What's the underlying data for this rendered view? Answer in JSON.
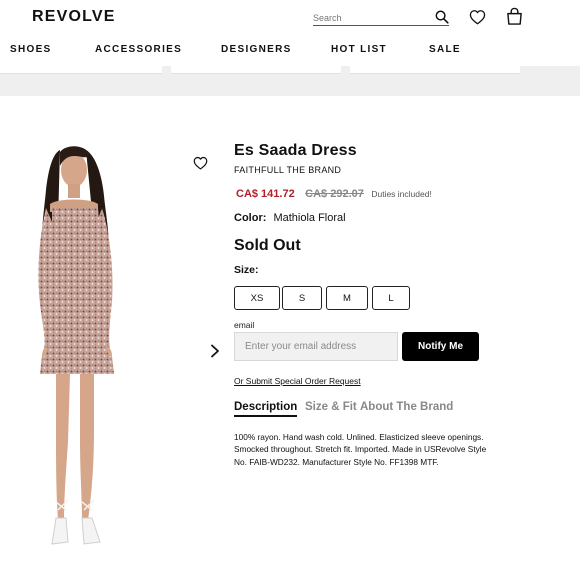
{
  "header": {
    "logo": "REVOLVE",
    "search_placeholder": "Search",
    "icons": {
      "search": "search-icon",
      "wishlist": "heart-icon",
      "bag": "shopping-bag-icon"
    }
  },
  "nav": {
    "items": [
      {
        "label": "SHOES"
      },
      {
        "label": "ACCESSORIES"
      },
      {
        "label": "DESIGNERS"
      },
      {
        "label": "HOT LIST"
      },
      {
        "label": "SALE"
      }
    ]
  },
  "product": {
    "title": "Es Saada Dress",
    "brand": "FAITHFULL THE BRAND",
    "sale_price": "CA$ 141.72",
    "original_price": "CA$ 292.07",
    "duties_note": "Duties included!",
    "color_label": "Color:",
    "color_value": "Mathiola Floral",
    "stock_status": "Sold Out",
    "size_label": "Size:",
    "sizes": [
      "XS",
      "S",
      "M",
      "L"
    ],
    "email_label": "email",
    "email_placeholder": "Enter your email address",
    "notify_button": "Notify Me",
    "special_order_link": "Or Submit Special Order Request",
    "tabs": [
      {
        "label": "Description",
        "active": true
      },
      {
        "label": "Size & Fit",
        "active": false
      },
      {
        "label": "About The Brand",
        "active": false
      }
    ],
    "description_lines": [
      "100% rayon. Hand wash cold. Unlined. Elasticized sleeve openings.",
      "Smocked throughout. Stretch fit. Imported. Made in USRevolve Style",
      "No. FAIB-WD232. Manufacturer Style No. FF1398 MTF."
    ]
  },
  "colors": {
    "sale_price": "#b0202a",
    "text": "#111111",
    "muted": "#888888",
    "button_bg": "#000000",
    "strip_bg": "#efefef"
  }
}
